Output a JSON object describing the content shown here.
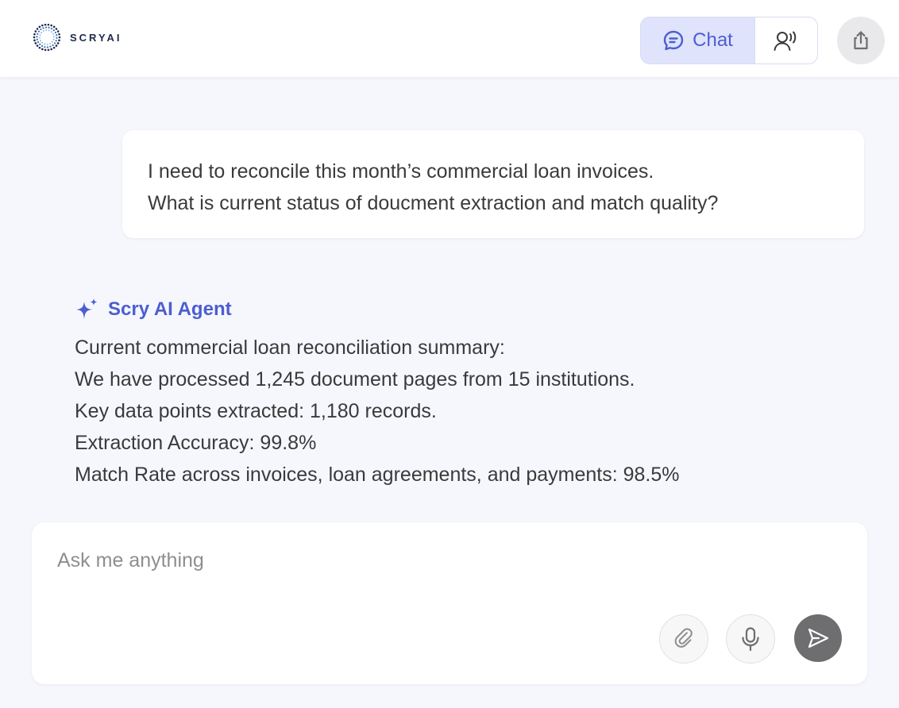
{
  "header": {
    "logo_text": "SCRYAI",
    "modes": {
      "chat_label": "Chat"
    }
  },
  "conversation": {
    "user_message": {
      "lines": [
        "I need to reconcile this month’s commercial loan invoices.",
        "What is current status of doucment extraction and match quality?"
      ]
    },
    "agent_message": {
      "name": "Scry AI Agent",
      "lines": [
        "Current commercial loan reconciliation summary:",
        "We have processed 1,245 document pages from 15 institutions.",
        "Key data points extracted: 1,180 records.",
        "Extraction Accuracy: 99.8%",
        "Match Rate across invoices, loan agreements, and payments: 98.5%"
      ]
    }
  },
  "composer": {
    "placeholder": "Ask me anything",
    "value": ""
  },
  "icons": {
    "logo": "scryai-dotted-ring-logo",
    "chat_mode": "chat-bubble-icon",
    "voice_mode": "voice-agent-icon",
    "share": "share-upload-icon",
    "agent": "sparkle-icon",
    "attach": "paperclip-icon",
    "mic": "microphone-icon",
    "send": "send-arrow-icon"
  },
  "colors": {
    "accent": "#4c5ed0",
    "chat_toggle_bg": "#dfe3fb",
    "page_bg": "#f6f7fd",
    "send_button": "#6e6e70"
  }
}
